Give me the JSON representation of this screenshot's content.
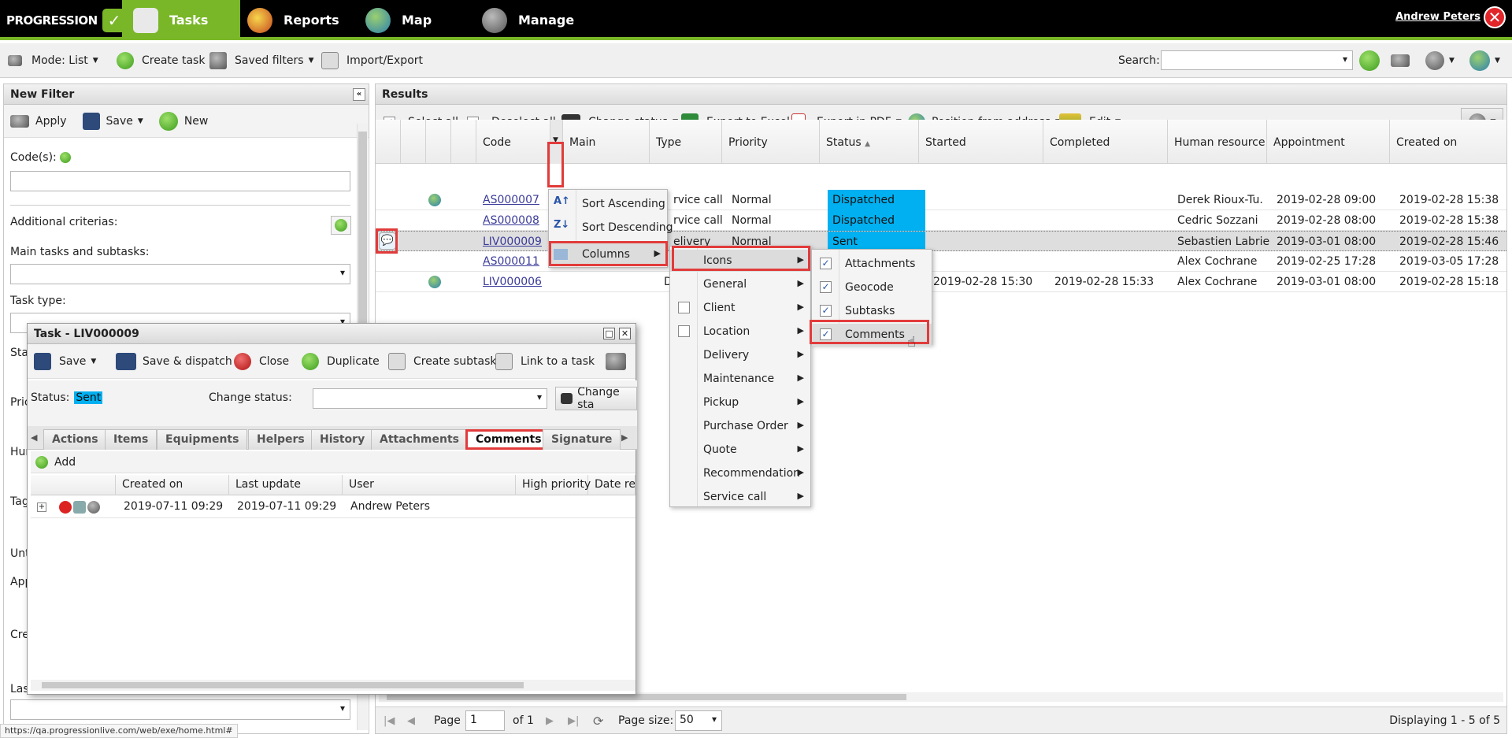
{
  "nav": {
    "brand": "PROGRESSION",
    "tabs": [
      "Tasks",
      "Reports",
      "Map",
      "Manage"
    ],
    "user": "Andrew Peters"
  },
  "toolbar": {
    "mode": "Mode: List",
    "create_task": "Create task",
    "saved_filters": "Saved filters",
    "import_export": "Import/Export",
    "search_label": "Search:",
    "search_value": ""
  },
  "filter": {
    "title": "New Filter",
    "apply": "Apply",
    "save": "Save",
    "new": "New",
    "codes_label": "Code(s):",
    "additional": "Additional criterias:",
    "main_tasks": "Main tasks and subtasks:",
    "task_type": "Task type:",
    "partial_labels": [
      "Sta",
      "Pric",
      "Hur",
      "Tag",
      "Unt",
      "App",
      "Cre",
      "Las"
    ]
  },
  "results": {
    "title": "Results",
    "select_all": "Select all",
    "deselect_all": "Deselect all",
    "change_status": "Change status",
    "export_excel": "Export to Excel",
    "export_pdf": "Export in PDF",
    "position": "Position from address",
    "edit": "Edit",
    "columns": [
      "Code",
      "Main",
      "Type",
      "Priority",
      "Status",
      "Started",
      "Completed",
      "Human resource",
      "Appointment",
      "Created on"
    ],
    "rows": [
      {
        "code": "AS000007",
        "type": "rvice call",
        "priority": "Normal",
        "status": "Dispatched",
        "started": "",
        "completed": "",
        "hr": "Derek Rioux-Tu...",
        "appointment": "2019-02-28 09:00",
        "created": "2019-02-28 15:38"
      },
      {
        "code": "AS000008",
        "type": "rvice call",
        "priority": "Normal",
        "status": "Dispatched",
        "started": "",
        "completed": "",
        "hr": "Cedric Sozzani",
        "appointment": "2019-02-28 08:00",
        "created": "2019-02-28 15:38"
      },
      {
        "code": "LIV000009",
        "type": "elivery",
        "priority": "Normal",
        "status": "Sent",
        "started": "",
        "completed": "",
        "hr": "Sebastien Labrie",
        "appointment": "2019-03-01 08:00",
        "created": "2019-02-28 15:46"
      },
      {
        "code": "AS000011",
        "type": "",
        "priority": "",
        "status": "",
        "started": "",
        "completed": "",
        "hr": "Alex Cochrane",
        "appointment": "2019-02-25 17:28",
        "created": "2019-03-05 17:28"
      },
      {
        "code": "LIV000006",
        "type": "De",
        "priority": "",
        "status": "",
        "started": "2019-02-28 15:30",
        "completed": "2019-02-28 15:33",
        "hr": "Alex Cochrane",
        "appointment": "2019-03-01 08:00",
        "created": "2019-02-28 15:18"
      }
    ],
    "pager": {
      "page_label": "Page",
      "page": "1",
      "of": "of 1",
      "page_size_label": "Page size:",
      "page_size": "50",
      "displaying": "Displaying 1 - 5 of 5"
    }
  },
  "menu": {
    "sort_asc": "Sort Ascending",
    "sort_desc": "Sort Descending",
    "columns": "Columns",
    "groups": [
      "Icons",
      "General",
      "Client",
      "Location",
      "Delivery",
      "Maintenance",
      "Pickup",
      "Purchase Order",
      "Quote",
      "Recommendation",
      "Service call"
    ],
    "icons_items": [
      "Attachments",
      "Geocode",
      "Subtasks",
      "Comments"
    ]
  },
  "task": {
    "title": "Task - LIV000009",
    "save": "Save",
    "save_dispatch": "Save & dispatch",
    "close": "Close",
    "duplicate": "Duplicate",
    "create_subtask": "Create subtask",
    "link": "Link to a task",
    "status_label": "Status:",
    "status_value": "Sent",
    "change_status_label": "Change status:",
    "change_status_btn": "Change sta",
    "tabs": [
      "Actions",
      "Items",
      "Equipments",
      "Helpers",
      "History",
      "Attachments",
      "Comments",
      "Signature"
    ],
    "add": "Add",
    "cols": [
      "Created on",
      "Last update",
      "User",
      "High priority",
      "Date re"
    ],
    "comment": {
      "created": "2019-07-11 09:29",
      "updated": "2019-07-11 09:29",
      "user": "Andrew Peters"
    }
  },
  "status_url": "https://qa.progressionlive.com/web/exe/home.html#"
}
